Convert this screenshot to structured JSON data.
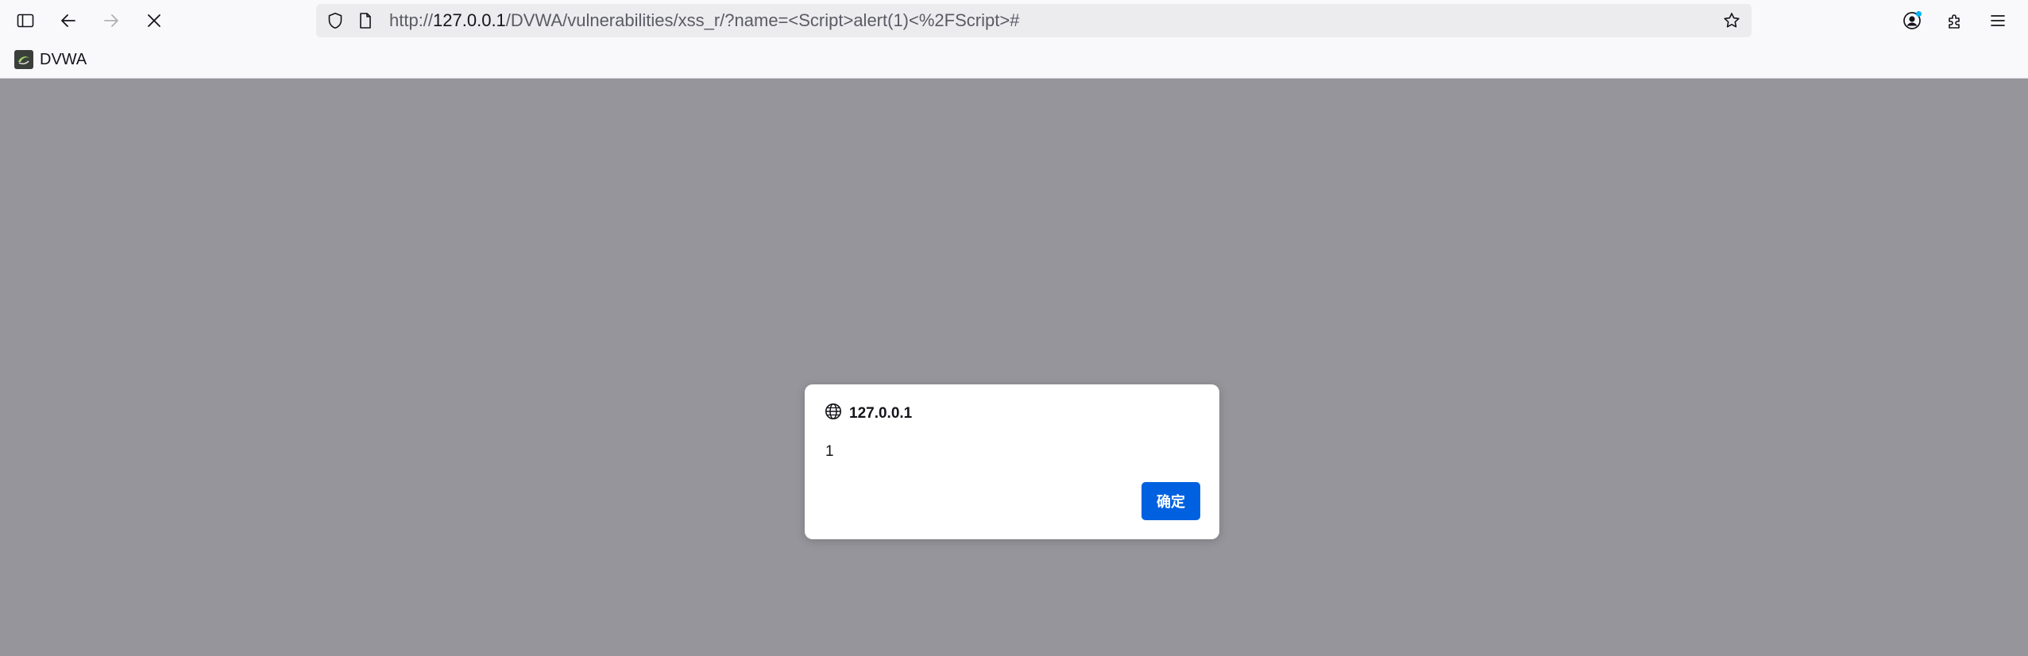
{
  "toolbar": {
    "sidebar_icon": "sidebar-icon",
    "back_icon": "back-arrow-icon",
    "forward_icon": "forward-arrow-icon",
    "stop_icon": "stop-icon",
    "url": {
      "scheme": "http://",
      "host": "127.0.0.1",
      "path": "/DVWA/vulnerabilities/xss_r/?name=<Script>alert(1)<%2FScript>#"
    },
    "shield_icon": "tracking-shield-icon",
    "page_icon": "page-icon",
    "star_icon": "bookmark-star-icon",
    "account_icon": "account-icon",
    "extensions_icon": "extensions-icon",
    "menu_icon": "hamburger-menu-icon"
  },
  "bookmarks": [
    {
      "label": "DVWA",
      "icon": "dvwa-favicon"
    }
  ],
  "dialog": {
    "origin": "127.0.0.1",
    "origin_icon": "globe-icon",
    "message": "1",
    "ok_label": "确定"
  },
  "colors": {
    "overlay": "#96959b",
    "accent": "#0061e0",
    "account_badge": "#00b3f4"
  }
}
